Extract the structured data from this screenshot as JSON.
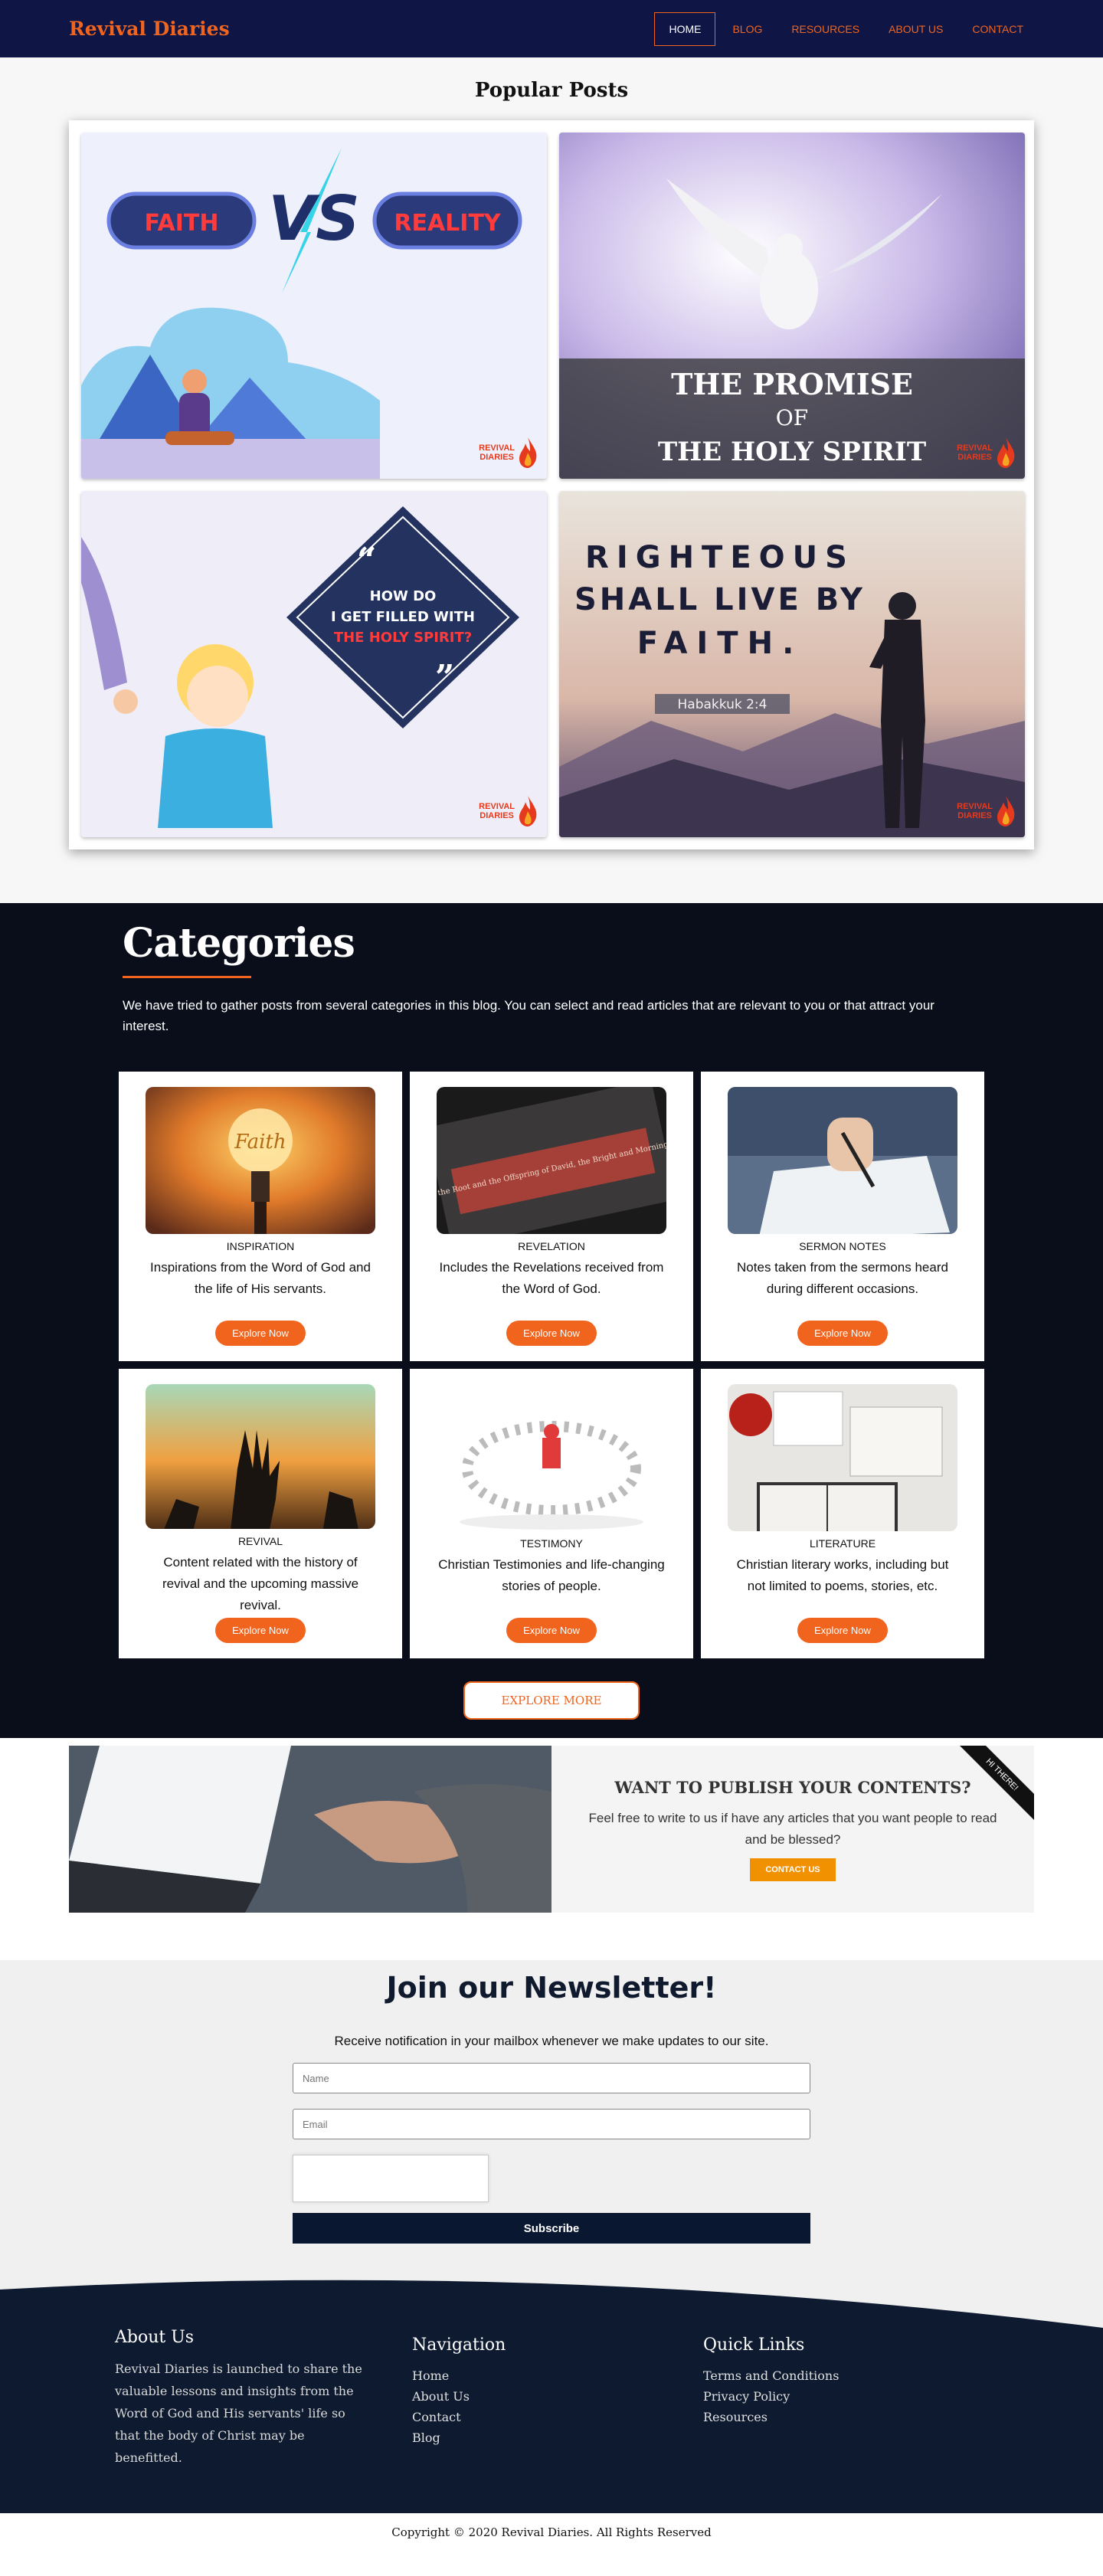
{
  "nav": {
    "brand": "Revival Diaries",
    "items": [
      {
        "label": "HOME",
        "active": true
      },
      {
        "label": "BLOG",
        "active": false
      },
      {
        "label": "RESOURCES",
        "active": false
      },
      {
        "label": "ABOUT US",
        "active": false
      },
      {
        "label": "CONTACT",
        "active": false
      }
    ]
  },
  "popular": {
    "title": "Popular Posts",
    "logo_text_1": "REVIVAL",
    "logo_text_2": "DIARIES",
    "posts": [
      {
        "left_word": "FAITH",
        "vs": "VS",
        "right_word": "REALITY"
      },
      {
        "line1": "THE PROMISE",
        "line2": "OF",
        "line3": "THE HOLY SPIRIT"
      },
      {
        "line1": "HOW DO",
        "line2": "I GET FILLED WITH",
        "line3": "THE HOLY SPIRIT?"
      },
      {
        "line1": "RIGHTEOUS",
        "line2": "SHALL LIVE BY",
        "line3": "FAITH.",
        "ref": "Habakkuk 2:4"
      }
    ]
  },
  "categories": {
    "title": "Categories",
    "description": "We have tried to gather posts from several categories in this blog. You can select and read articles that are relevant to you or that attract your interest.",
    "button_label": "Explore Now",
    "explore_more": "EXPLORE MORE",
    "items": [
      {
        "name": "INSPIRATION",
        "text": "Inspirations from the Word of God and the life of His servants.",
        "image_text": "Faith"
      },
      {
        "name": "REVELATION",
        "text": "Includes the Revelations received from the Word of God.",
        "image_text": "I am the Root and the Offspring of David, the Bright and Morning Star"
      },
      {
        "name": "SERMON NOTES",
        "text": "Notes taken from the sermons heard during different occasions."
      },
      {
        "name": "REVIVAL",
        "text": "Content related with the history of revival and the upcoming massive revival."
      },
      {
        "name": "TESTIMONY",
        "text": "Christian Testimonies and life-changing stories of people."
      },
      {
        "name": "LITERATURE",
        "text": "Christian literary works, including but not limited to poems, stories, etc."
      }
    ]
  },
  "publish": {
    "title": "WANT TO PUBLISH YOUR CONTENTS?",
    "text": "Feel free to write to us if have any articles that you want people to read and be blessed?",
    "button": "CONTACT US",
    "ribbon": "HI THERE!"
  },
  "newsletter": {
    "title": "Join our Newsletter!",
    "subtitle": "Receive notification in your mailbox whenever we make updates to our site.",
    "name_placeholder": "Name",
    "email_placeholder": "Email",
    "button": "Subscribe"
  },
  "footer": {
    "about_title": "About Us",
    "about_text": "Revival Diaries is launched to share the valuable lessons and insights from the Word of God and His servants' life so that the body of Christ may be benefitted.",
    "nav_title": "Navigation",
    "nav_links": [
      "Home",
      "About Us",
      "Contact",
      "Blog"
    ],
    "quick_title": "Quick Links",
    "quick_links": [
      "Terms and Conditions",
      "Privacy Policy",
      "Resources"
    ],
    "copyright": "Copyright © 2020 Revival Diaries. All Rights Reserved"
  },
  "colors": {
    "accent": "#f0641e",
    "nav_bg": "#0f1645",
    "categories_bg": "#0a0e1a",
    "footer_bg": "#0d1a30"
  }
}
